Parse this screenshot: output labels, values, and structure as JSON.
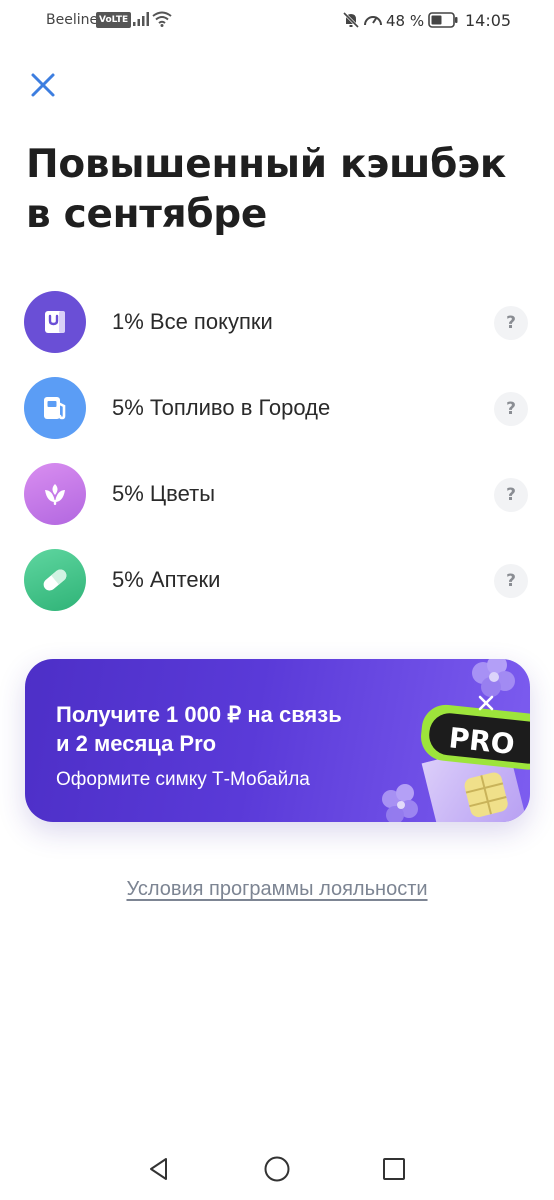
{
  "status_bar": {
    "carrier": "Beeline",
    "volte": "VoLTE",
    "battery_percent": "48 %",
    "time": "14:05",
    "icons": [
      "signal-icon",
      "wifi-icon",
      "bell-muted-icon",
      "speed-icon",
      "battery-icon"
    ]
  },
  "header": {
    "close_icon": "close-icon",
    "title_line1": "Повышенный кэшбэк",
    "title_line2": "в сентябре"
  },
  "cashback_items": [
    {
      "label": "1% Все покупки",
      "icon": "shopping-bag-icon",
      "color": "#6a4fd6",
      "help": "?"
    },
    {
      "label": "5% Топливо в Городе",
      "icon": "fuel-icon",
      "color": "#5b9df5",
      "help": "?"
    },
    {
      "label": "5% Цветы",
      "icon": "flower-icon",
      "color": "#c97be8",
      "help": "?"
    },
    {
      "label": "5% Аптеки",
      "icon": "pill-icon",
      "color": "#3fc28a",
      "help": "?"
    }
  ],
  "promo": {
    "title_line1": "Получите 1 000 ₽ на связь",
    "title_line2": "и 2 месяца Pro",
    "subtitle": "Оформите симку Т-Мобайла",
    "badge_text": "PRO",
    "background": "#5a3ad8"
  },
  "terms_link": "Условия программы лояльности",
  "nav": {
    "icons": [
      "back-icon",
      "home-icon",
      "recent-apps-icon"
    ]
  }
}
